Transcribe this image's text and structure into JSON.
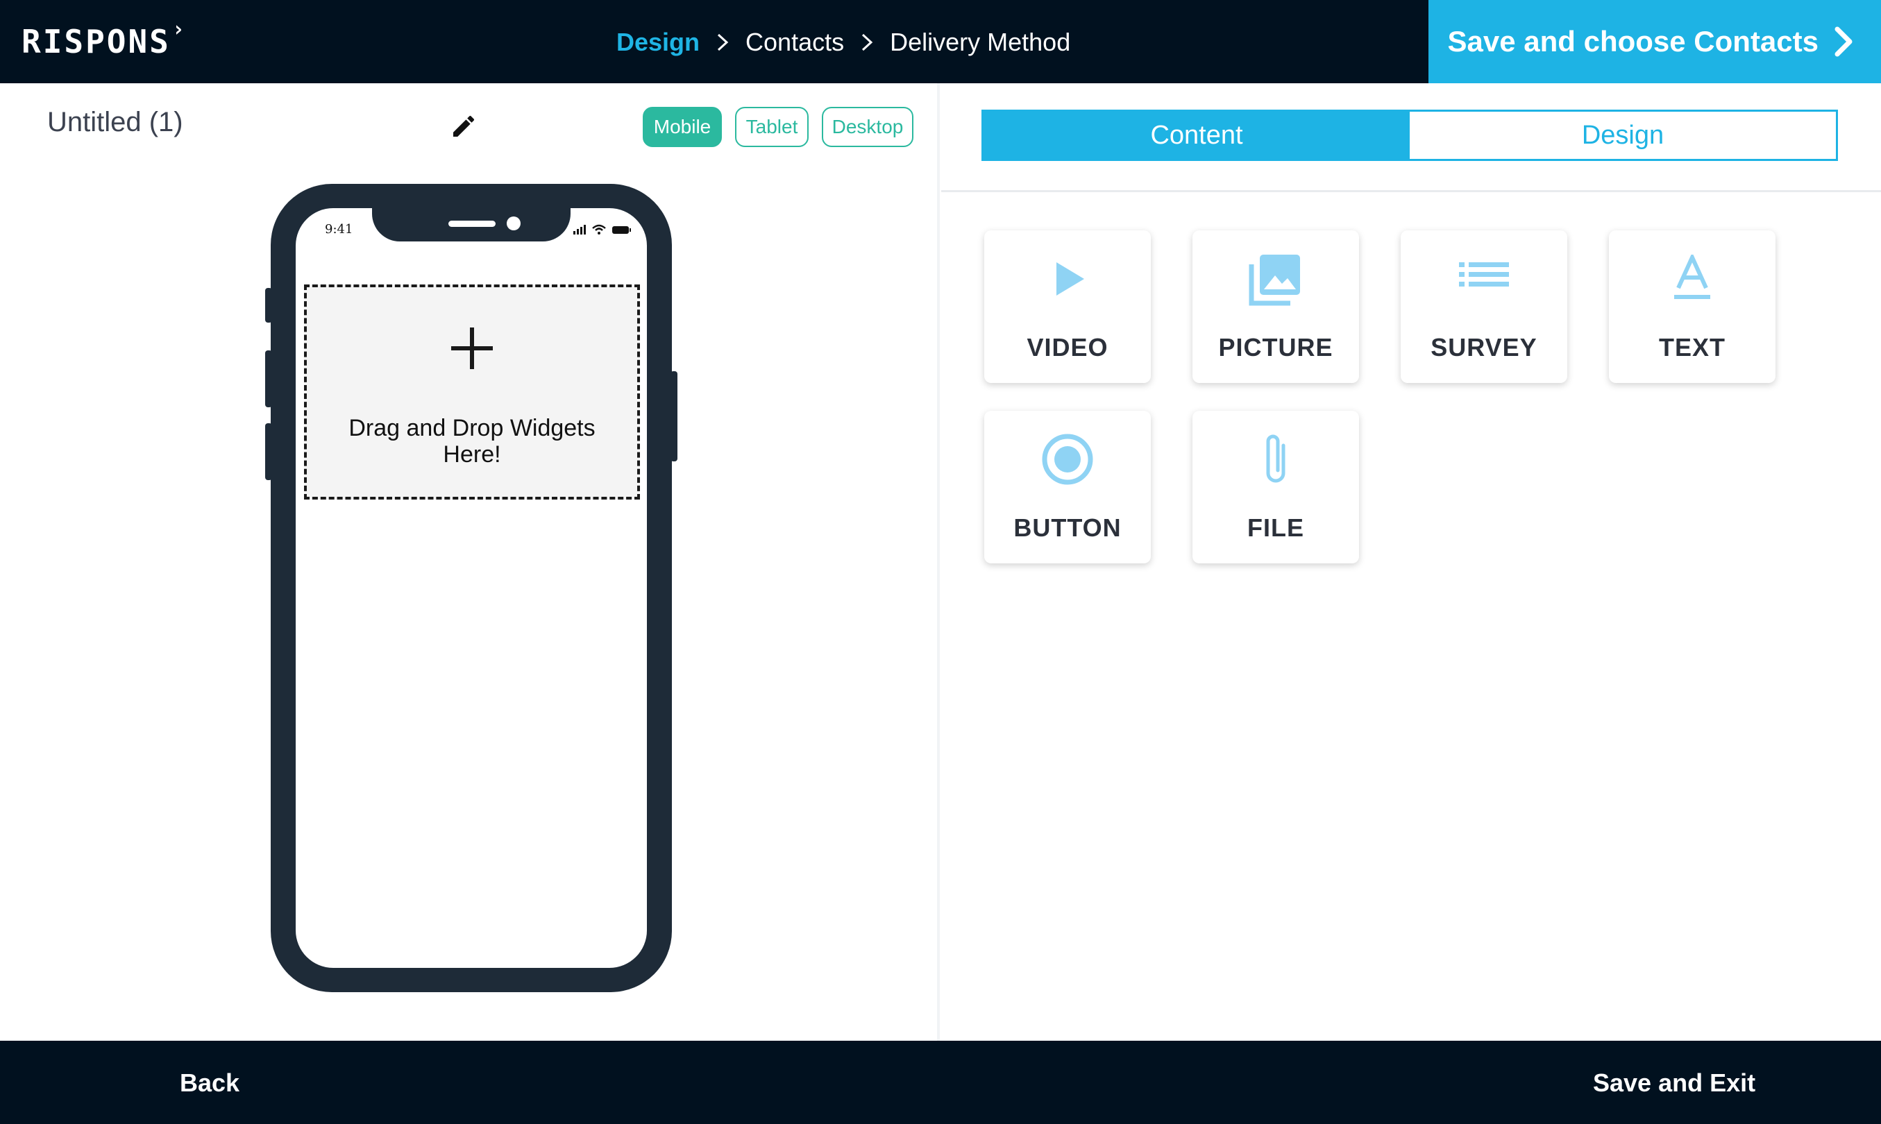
{
  "header": {
    "logo_text": "RISPONS",
    "logo_mark": "›",
    "breadcrumb": [
      {
        "label": "Design",
        "active": true
      },
      {
        "label": "Contacts",
        "active": false
      },
      {
        "label": "Delivery Method",
        "active": false
      }
    ],
    "primary_action": "Save and choose Contacts"
  },
  "editor": {
    "title": "Untitled (1)",
    "edit_icon": "pencil-icon",
    "device_modes": [
      {
        "label": "Mobile",
        "active": true
      },
      {
        "label": "Tablet",
        "active": false
      },
      {
        "label": "Desktop",
        "active": false
      }
    ],
    "phone": {
      "time": "9:41",
      "dropzone_text": "Drag and Drop Widgets Here!"
    }
  },
  "panel": {
    "tabs": [
      {
        "label": "Content",
        "active": true
      },
      {
        "label": "Design",
        "active": false
      }
    ],
    "widgets": [
      {
        "label": "VIDEO",
        "icon": "play-icon"
      },
      {
        "label": "PICTURE",
        "icon": "image-icon"
      },
      {
        "label": "SURVEY",
        "icon": "list-icon"
      },
      {
        "label": "TEXT",
        "icon": "text-icon"
      },
      {
        "label": "BUTTON",
        "icon": "radio-button-icon"
      },
      {
        "label": "FILE",
        "icon": "paperclip-icon"
      }
    ]
  },
  "footer": {
    "back_label": "Back",
    "save_exit_label": "Save and Exit"
  },
  "colors": {
    "navbar": "#01111f",
    "accent_blue": "#1eb3e4",
    "accent_green": "#2bb99f",
    "widget_icon": "#8fd3f4"
  }
}
